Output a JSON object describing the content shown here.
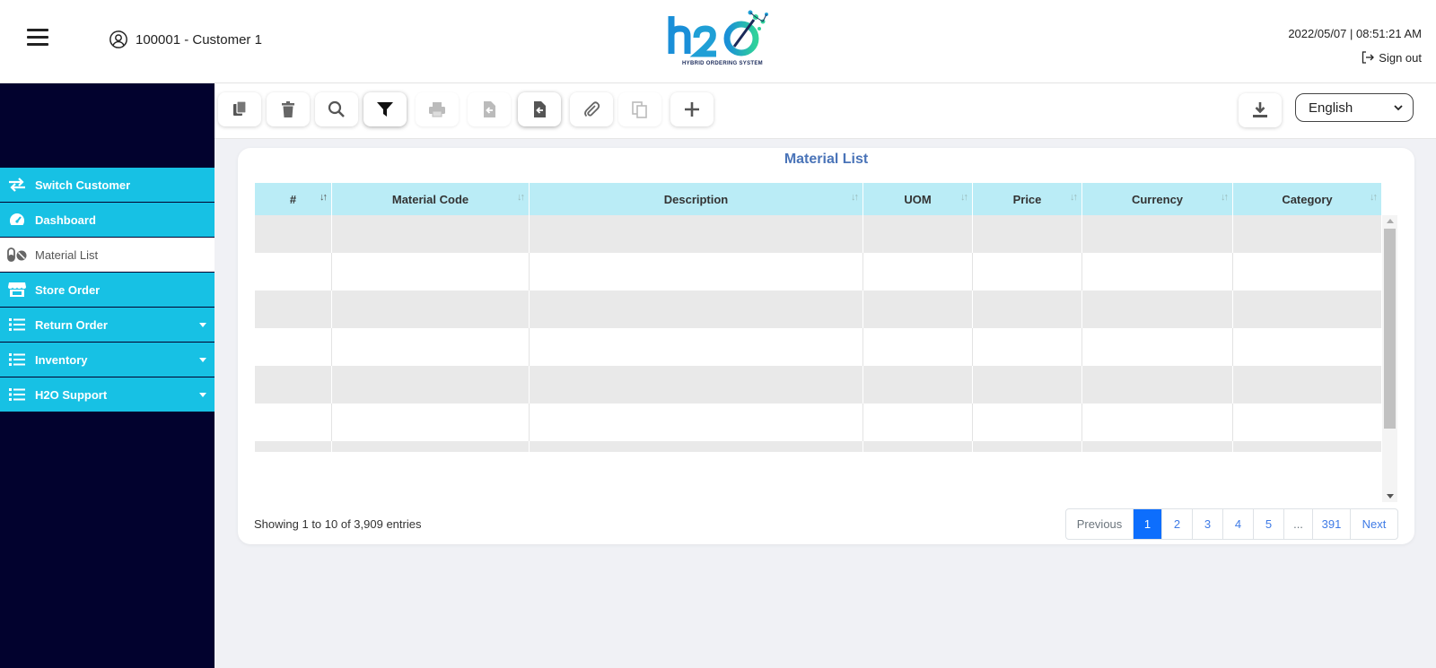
{
  "header": {
    "customer": "100001 - Customer 1",
    "logo_subtitle": "HYBRID ORDERING SYSTEM",
    "datetime": "2022/05/07 | 08:51:21 AM",
    "signout": "Sign out"
  },
  "sidebar": {
    "items": [
      {
        "label": "Switch Customer",
        "icon": "switch-icon",
        "active": false
      },
      {
        "label": "Dashboard",
        "icon": "dashboard-icon",
        "active": false
      },
      {
        "label": "Material List",
        "icon": "pills-icon",
        "active": true
      },
      {
        "label": "Store Order",
        "icon": "store-icon",
        "active": false
      },
      {
        "label": "Return Order",
        "icon": "list-icon",
        "active": false,
        "dropdown": true
      },
      {
        "label": "Inventory",
        "icon": "list-icon",
        "active": false,
        "dropdown": true
      },
      {
        "label": "H2O Support",
        "icon": "list-icon",
        "active": false,
        "dropdown": true
      }
    ]
  },
  "toolbar": {
    "buttons": [
      "copy-icon",
      "trash-icon",
      "search-icon",
      "filter-icon",
      "print-icon",
      "import-icon",
      "export-icon",
      "attachment-icon",
      "duplicate-icon",
      "plus-icon"
    ],
    "download_icon": "download-icon",
    "language": "English"
  },
  "main": {
    "title": "Material List",
    "columns": [
      "#",
      "Material Code",
      "Description",
      "UOM",
      "Price",
      "Currency",
      "Category"
    ],
    "rows_visible": 7,
    "entries_text": "Showing 1 to 10 of 3,909 entries",
    "pagination": {
      "previous": "Previous",
      "pages": [
        "1",
        "2",
        "3",
        "4",
        "5",
        "...",
        "391"
      ],
      "current": "1",
      "next": "Next"
    }
  },
  "colors": {
    "sidebar_bg": "#02022e",
    "menu_accent": "#17c1e4",
    "header_row": "#baecf6",
    "title_blue": "#4a74b8",
    "page_active": "#0d6efd"
  }
}
